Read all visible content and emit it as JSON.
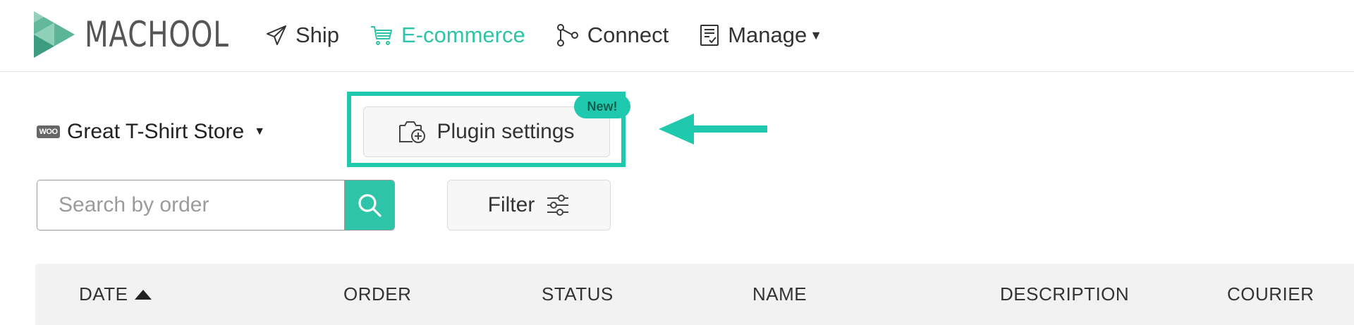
{
  "brand": {
    "name": "MACHOOL"
  },
  "nav": {
    "items": [
      {
        "label": "Ship",
        "icon": "paper-plane-icon",
        "active": false
      },
      {
        "label": "E-commerce",
        "icon": "cart-icon",
        "active": true
      },
      {
        "label": "Connect",
        "icon": "connect-nodes-icon",
        "active": false
      },
      {
        "label": "Manage",
        "icon": "clipboard-check-icon",
        "active": false,
        "has_dropdown": true
      }
    ]
  },
  "store": {
    "badge": "WOO",
    "name": "Great T-Shirt Store"
  },
  "plugin": {
    "label": "Plugin settings",
    "badge": "New!"
  },
  "search": {
    "placeholder": "Search by order",
    "value": ""
  },
  "filter": {
    "label": "Filter"
  },
  "table": {
    "columns": [
      "DATE",
      "ORDER",
      "STATUS",
      "NAME",
      "DESCRIPTION",
      "COURIER"
    ],
    "sort_column": "DATE",
    "sort_direction": "ascending"
  },
  "colors": {
    "accent": "#2ec4a8",
    "highlight": "#1ec9ad",
    "text": "#333333",
    "header_bg": "#f2f2f2"
  }
}
